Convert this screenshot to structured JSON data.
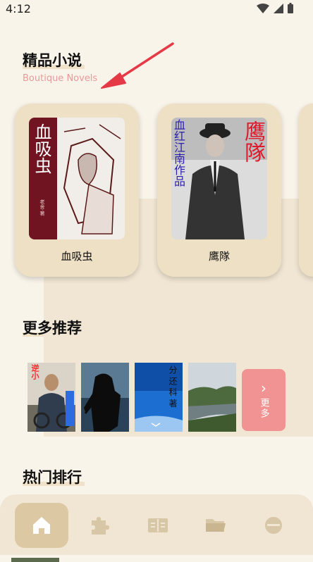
{
  "status_bar": {
    "time": "4:12"
  },
  "featured": {
    "title": "精品小说",
    "subtitle": "Boutique Novels",
    "books": [
      {
        "title": "血吸虫",
        "cover_text": "血吸虫",
        "cover_author": "老舍·著"
      },
      {
        "title": "鹰隊",
        "cover_text": "鹰隊",
        "cover_side_text": "血红江南作品"
      }
    ]
  },
  "recommend": {
    "title": "更多推荐",
    "covers": [
      {
        "overlay": "逆小"
      },
      {
        "overlay": ""
      },
      {
        "overlay": "分 还 科 著"
      },
      {
        "overlay": ""
      }
    ],
    "more_label": "更多"
  },
  "hot": {
    "title": "热门排行"
  },
  "nav": {
    "items": [
      {
        "name": "home-icon",
        "active": true
      },
      {
        "name": "puzzle-icon",
        "active": false
      },
      {
        "name": "book-icon",
        "active": false
      },
      {
        "name": "folder-icon",
        "active": false
      },
      {
        "name": "profile-icon",
        "active": false
      }
    ]
  },
  "colors": {
    "accent": "#f29393",
    "card": "#eee0c4",
    "nav": "#f1e6d3",
    "background": "#f9f4ea",
    "arrow": "#e63946"
  }
}
